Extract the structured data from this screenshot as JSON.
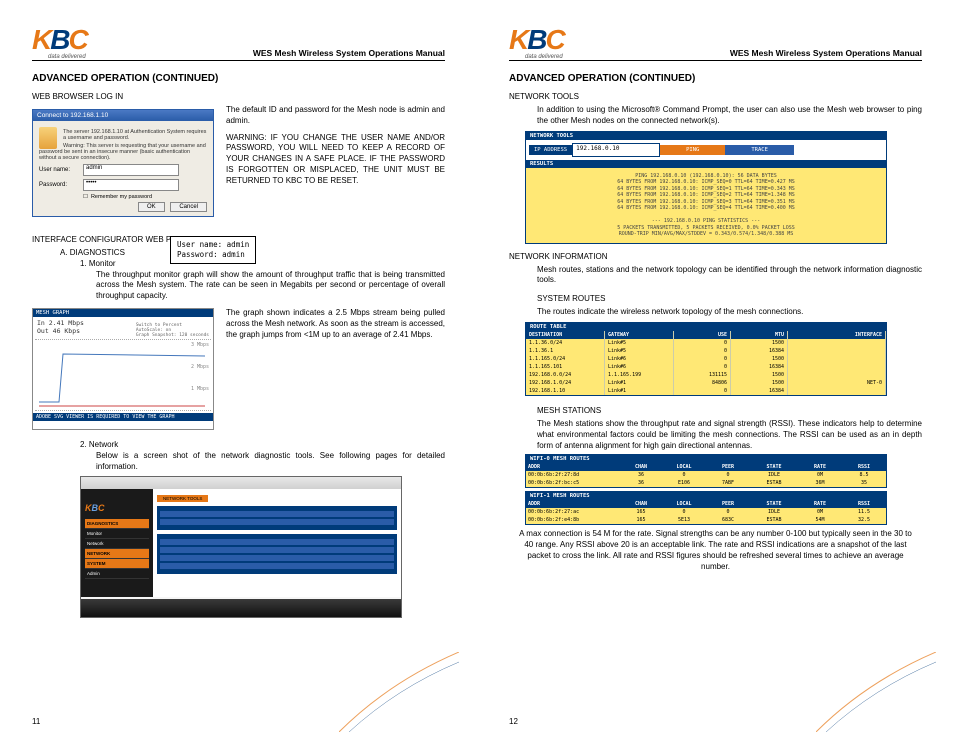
{
  "logo": {
    "tag": "data delivered"
  },
  "header_title": "WES Mesh Wireless System Operations Manual",
  "p1": {
    "section_title": "ADVANCED OPERATION (CONTINUED)",
    "web_login_label": "WEB BROWSER LOG IN",
    "login_dialog": {
      "titlebar": "Connect to 192.168.1.10",
      "server_line": "The server 192.168.1.10 at Authentication System requires a username and password.",
      "warn_line": "Warning: This server is requesting that your username and password be sent in an insecure manner (basic authentication without a secure connection).",
      "user_label": "User name:",
      "pass_label": "Password:",
      "user_value": "admin",
      "remember": "Remember my password",
      "ok": "OK",
      "cancel": "Cancel"
    },
    "login_text1": "The default ID and password for the Mesh node is admin and admin.",
    "login_text2": "WARNING:  IF YOU CHANGE THE USER NAME AND/OR PASSWORD, YOU WILL NEED TO KEEP A RECORD OF YOUR CHANGES IN A SAFE PLACE.  IF THE PASSWORD IS FORGOTTEN OR MISPLACED, THE UNIT MUST BE RETURNED TO KBC TO BE RESET.",
    "callout": {
      "l1": "User name:       admin",
      "l2": "Password:        admin"
    },
    "interface_label": "INTERFACE CONFIGURATOR WEB PAGES",
    "diag_a": "A.    DIAGNOSTICS",
    "diag_1": "1.    Monitor",
    "diag_1_text": "The throughput monitor graph will show the amount of throughput traffic that is being transmitted across the Mesh system. The rate can be seen in Megabits per second or percentage of overall throughput capacity.",
    "graph": {
      "header": "MESH GRAPH",
      "in": "In  2.41 Mbps",
      "out": "Out 46 Kbps",
      "switch": "Switch to Percent",
      "autoscale": "AutoScale: on",
      "snapshot": "Graph Snapshot: 120 seconds",
      "l3": "3 Mbps",
      "l2": "2 Mbps",
      "l1": "1 Mbps",
      "footer": "ADOBE SVG VIEWER   IS REQUIRED TO VIEW THE GRAPH"
    },
    "graph_text": "The graph shown indicates a 2.5 Mbps stream being pulled across the Mesh network. As soon as the stream is accessed, the graph jumps from <1M up to an average of 2.41 Mbps.",
    "diag_2": "2.    Network",
    "diag_2_text": "Below is a screen shot of the network diagnostic tools. See following pages for detailed information.",
    "ss": {
      "nav": [
        "DIAGNOSTICS",
        "Monitor",
        "Network",
        "NETWORK",
        "SYSTEM",
        "Admin"
      ],
      "tab": "NETWORK TOOLS"
    },
    "page_num": "11"
  },
  "p2": {
    "section_title": "ADVANCED OPERATION (CONTINUED)",
    "nt_label": "NETWORK TOOLS",
    "nt_text": "In addition to using the Microsoft® Command Prompt, the user can also use the Mesh web browser to ping the other Mesh nodes on the connected network(s).",
    "nt": {
      "header": "NETWORK TOOLS",
      "ip_label": "IP ADDRESS",
      "ip_value": "192.168.0.10",
      "ping": "PING",
      "trace": "TRACE",
      "results_header": "RESULTS",
      "results": "PING 192.168.0.10 (192.168.0.10): 56 DATA BYTES\n64 BYTES FROM 192.168.0.10: ICMP_SEQ=0 TTL=64 TIME=0.427 MS\n64 BYTES FROM 192.168.0.10: ICMP_SEQ=1 TTL=64 TIME=0.343 MS\n64 BYTES FROM 192.168.0.10: ICMP_SEQ=2 TTL=64 TIME=1.348 MS\n64 BYTES FROM 192.168.0.10: ICMP_SEQ=3 TTL=64 TIME=0.351 MS\n64 BYTES FROM 192.168.0.10: ICMP_SEQ=4 TTL=64 TIME=0.400 MS\n\n--- 192.168.0.10 PING STATISTICS ---\n5 PACKETS TRANSMITTED, 5 PACKETS RECEIVED, 0.0% PACKET LOSS\nROUND-TRIP MIN/AVG/MAX/STDDEV = 0.343/0.574/1.348/0.388 MS"
    },
    "ni_label": "NETWORK INFORMATION",
    "ni_text": "Mesh routes, stations and the network topology can be identified through the network information diagnostic tools.",
    "sr_label": "SYSTEM ROUTES",
    "sr_text": "The routes indicate the wireless network topology of the mesh connections.",
    "route_table": {
      "caption": "ROUTE TABLE",
      "head": [
        "DESTINATION",
        "GATEWAY",
        "USE",
        "MTU",
        "INTERFACE"
      ],
      "rows": [
        [
          "1.1.36.0/24",
          "Link#5",
          "0",
          "1500",
          ""
        ],
        [
          "1.1.36.1",
          "Link#5",
          "0",
          "16384",
          ""
        ],
        [
          "1.1.165.0/24",
          "Link#6",
          "0",
          "1500",
          ""
        ],
        [
          "1.1.165.101",
          "Link#6",
          "0",
          "16384",
          ""
        ],
        [
          "192.168.0.0/24",
          "1.1.165.199",
          "131115",
          "1500",
          ""
        ],
        [
          "192.168.1.0/24",
          "Link#1",
          "84806",
          "1500",
          "NET-0"
        ],
        [
          "192.168.1.10",
          "Link#1",
          "0",
          "16384",
          ""
        ]
      ]
    },
    "ms_label": "MESH STATIONS",
    "ms_text": "The Mesh stations show the throughput rate and signal strength (RSSI). These indicators help to determine what environmental factors could be limiting the mesh connections. The RSSI can be used as an in depth form of antenna alignment for high gain directional antennas.",
    "mesh0": {
      "caption": "WIFI-0 MESH ROUTES",
      "head": [
        "ADDR",
        "CHAN",
        "LOCAL",
        "PEER",
        "STATE",
        "RATE",
        "RSSI"
      ],
      "rows": [
        [
          "00:0b:6b:2f:27:8d",
          "36",
          "0",
          "0",
          "IDLE",
          "0M",
          "8.5"
        ],
        [
          "00:0b:6b:2f:bc:c5",
          "36",
          "E106",
          "7ABF",
          "ESTAB",
          "36M",
          "35"
        ]
      ]
    },
    "mesh1": {
      "caption": "WIFI-1 MESH ROUTES",
      "head": [
        "ADDR",
        "CHAN",
        "LOCAL",
        "PEER",
        "STATE",
        "RATE",
        "RSSI"
      ],
      "rows": [
        [
          "00:0b:6b:2f:27:ac",
          "165",
          "0",
          "0",
          "IDLE",
          "0M",
          "11.5"
        ],
        [
          "00:0b:6b:2f:e4:8b",
          "165",
          "5E13",
          "683C",
          "ESTAB",
          "54M",
          "32.5"
        ]
      ]
    },
    "tail_text": "A max connection is 54 M for the rate. Signal strengths can be any number 0-100 but typically seen in the 30 to 40 range. Any RSSI above 20 is an acceptable link. The rate and RSSI indications are a snapshot of the last packet to cross the link. All rate and RSSI figures should be refreshed several times to achieve an average number.",
    "page_num": "12"
  }
}
